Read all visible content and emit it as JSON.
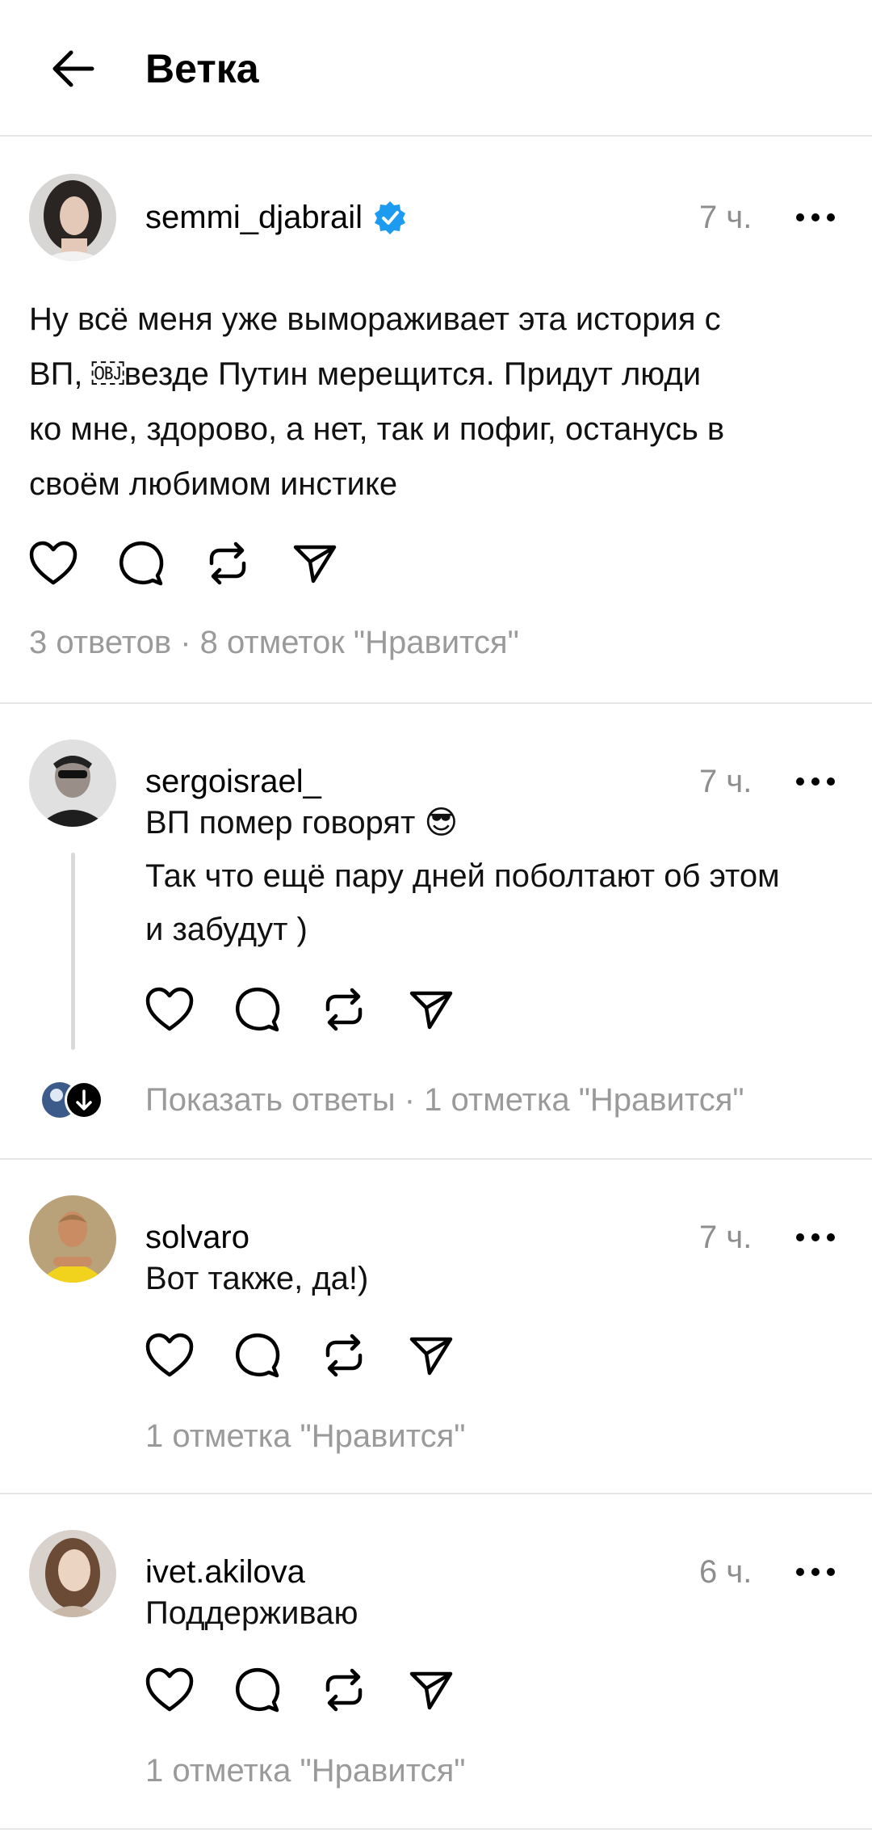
{
  "header": {
    "title": "Ветка",
    "back_icon": "arrow-left-icon"
  },
  "colors": {
    "verified": "#1d9bf0",
    "muted": "#8e8e8e",
    "divider": "#e6e6e6"
  },
  "main_post": {
    "username": "semmi_djabrail",
    "verified": true,
    "time": "7 ч.",
    "text_lines": [
      "Ну всё меня уже вымораживает эта история с",
      "ВП, ￼везде Путин мерещится. Придут люди",
      "ко мне, здорово, а нет, так и пофиг, останусь в",
      "своём любимом инстике"
    ],
    "stats": "3 ответов · 8 отметок \"Нравится\""
  },
  "replies": [
    {
      "username": "sergoisrael_",
      "time": "7 ч.",
      "text_lines": [
        "ВП помер говорят 😎",
        "Так что ещё пару дней поболтают об этом",
        "и забудут )"
      ],
      "stats": "Показать ответы · 1 отметка \"Нравится\""
    },
    {
      "username": "solvaro",
      "time": "7 ч.",
      "text_lines": [
        "Вот также, да!)"
      ],
      "stats": "1 отметка \"Нравится\""
    },
    {
      "username": "ivet.akilova",
      "time": "6 ч.",
      "text_lines": [
        "Поддерживаю"
      ],
      "stats": "1 отметка \"Нравится\""
    }
  ]
}
